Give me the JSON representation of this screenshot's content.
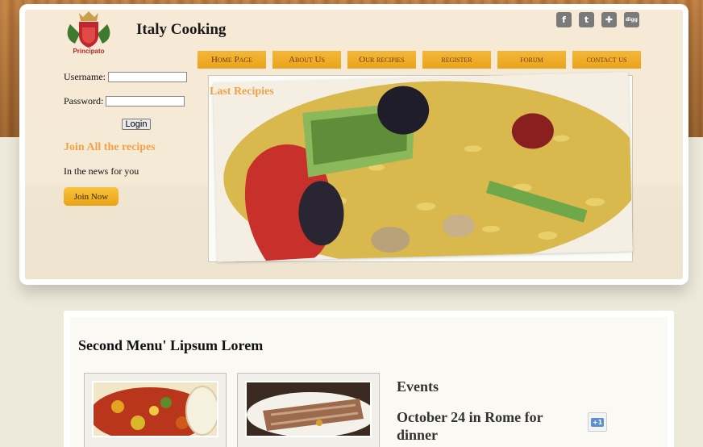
{
  "site": {
    "title": "Italy Cooking",
    "logo_text": "Principato"
  },
  "social": [
    {
      "name": "facebook-icon",
      "glyph": "f"
    },
    {
      "name": "twitter-icon",
      "glyph": "t"
    },
    {
      "name": "myspace-icon",
      "glyph": "✚"
    },
    {
      "name": "digg-icon",
      "glyph": "digg"
    }
  ],
  "nav": {
    "items": [
      "Home Page",
      "About Us",
      "Our recipies",
      "register",
      "forum",
      "contact us"
    ]
  },
  "login": {
    "username_label": "Username:",
    "password_label": "Password:",
    "button_label": "Login"
  },
  "join": {
    "title": "Join All the recipes",
    "news": "In the news for you",
    "button_label": "Join Now"
  },
  "slider": {
    "caption": "Last Recipies"
  },
  "content": {
    "section_title": "Second Menu' Lipsum Lorem",
    "events_heading": "Events",
    "event_title": "October 24 in Rome for dinner",
    "plusone_label": "+1"
  },
  "colors": {
    "accent_orange": "#f0a24a",
    "nav_gold": "#eeaa24",
    "wood": "#b9773b"
  }
}
